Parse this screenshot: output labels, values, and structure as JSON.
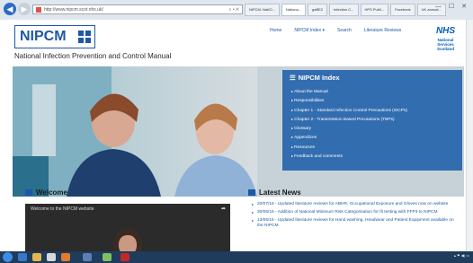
{
  "browser": {
    "address": "http://www.nipcm.scot.nhs.uk/",
    "tabs": [
      "NIPCM: NatIO...",
      "Nationa...",
      "gaBE2",
      "Infection C...",
      "HPS Publi...",
      "Facebook",
      "UK annual..."
    ],
    "active_tab_index": 1
  },
  "header": {
    "logo": "NIPCM",
    "tagline": "National Infection Prevention and Control Manual",
    "nav": [
      "Home",
      "NIPCM Index ▾",
      "Search",
      "Literature Reviews"
    ],
    "nhs": {
      "badge": "NHS",
      "line1": "National",
      "line2": "Services",
      "line3": "Scotland"
    }
  },
  "index_panel": {
    "title": "NIPCM Index",
    "items": [
      "About the Manual",
      "Responsibilities",
      "Chapter 1 - Standard Infection Control Precautions (SICPs)",
      "Chapter 2 - Transmission Based Precautions (TBPs)",
      "Glossary",
      "Appendices",
      "Resources",
      "Feedback and comments"
    ]
  },
  "welcome": {
    "title": "Welcome",
    "video_title": "Welcome to the NIPCM website"
  },
  "news": {
    "title": "Latest News",
    "items": [
      "20/07/16 - Updated literature reviews for ABHR, Occupational Exposure and Gloves now on website",
      "30/05/16 - Addition of National Minimum Risk Categorisation for fit testing with FFP3 to NIPCM",
      "13/05/16 - Updated literature reviews for Hand washing, Headwear and Patient Equipment available on the NIPCM"
    ]
  },
  "colors": {
    "brand": "#1d58a8",
    "panel": "#1e5faa",
    "nhs": "#005eb8"
  }
}
